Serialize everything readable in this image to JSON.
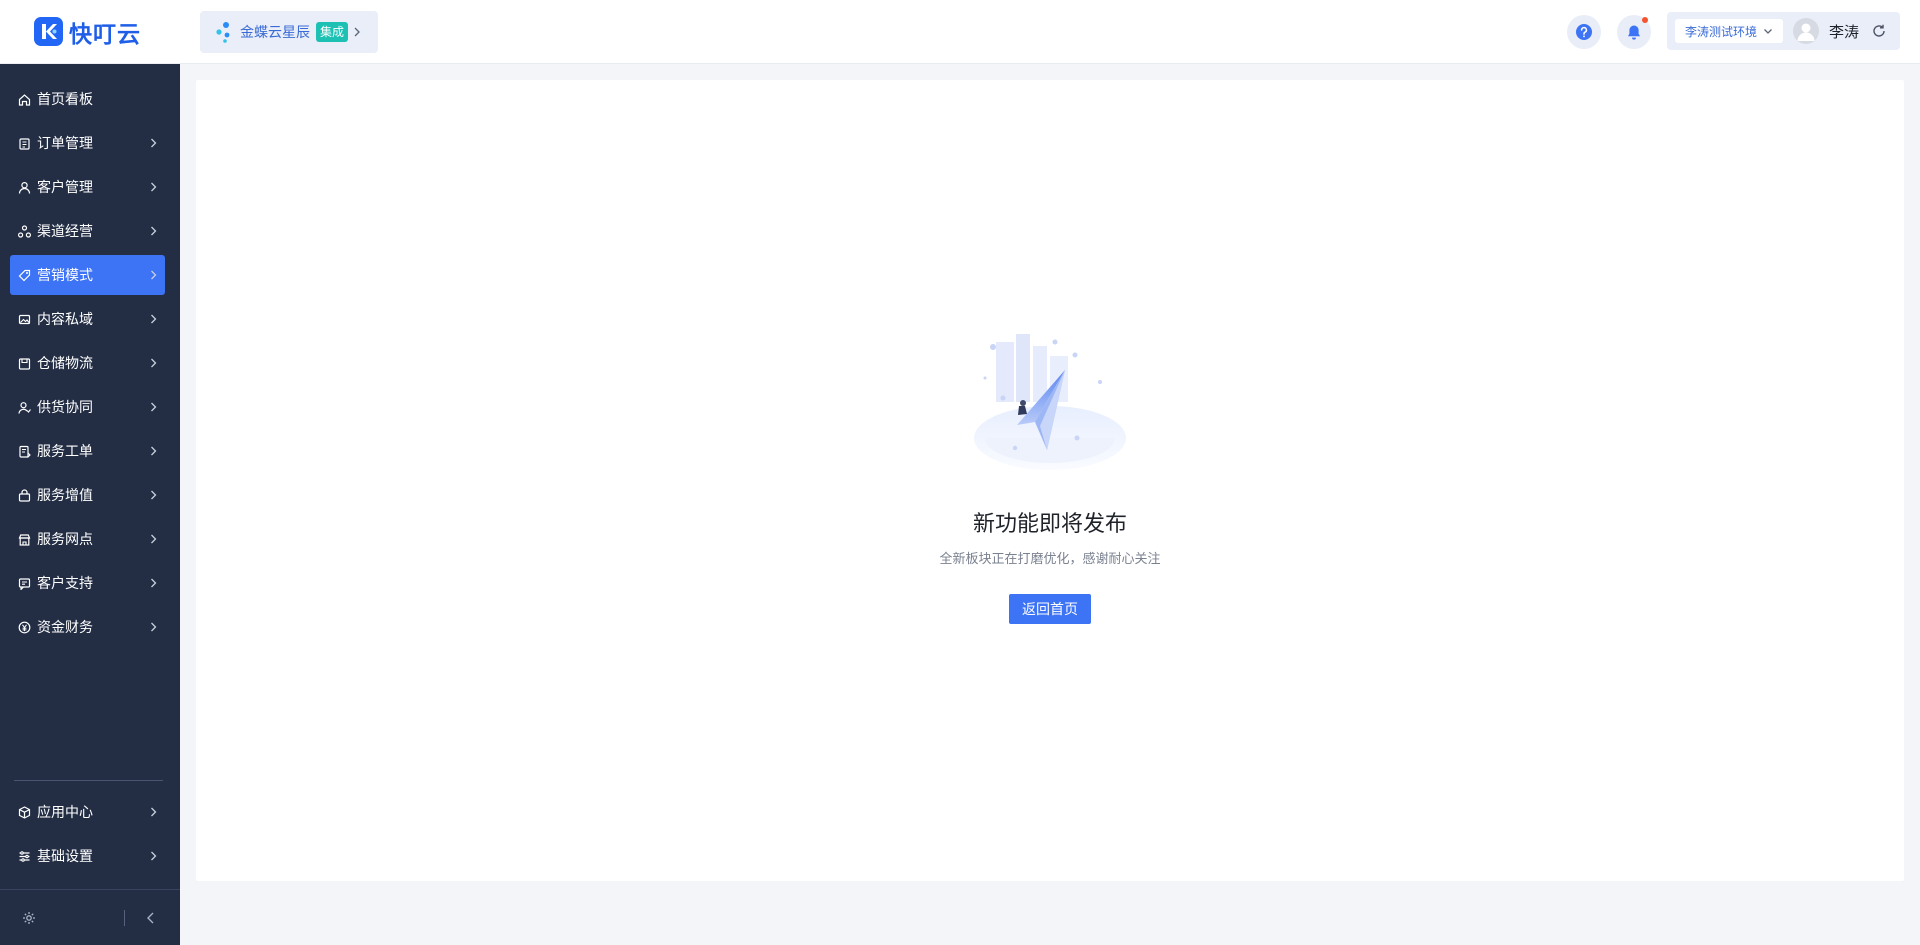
{
  "app": {
    "name": "快叮云",
    "brand_color": "#2266f5"
  },
  "sidebar": {
    "items": [
      {
        "label": "首页看板",
        "icon": "home-icon",
        "has_children": false,
        "active": false
      },
      {
        "label": "订单管理",
        "icon": "clipboard-icon",
        "has_children": true,
        "active": false
      },
      {
        "label": "客户管理",
        "icon": "user-icon",
        "has_children": true,
        "active": false
      },
      {
        "label": "渠道经营",
        "icon": "channel-icon",
        "has_children": true,
        "active": false
      },
      {
        "label": "营销模式",
        "icon": "tag-icon",
        "has_children": true,
        "active": true
      },
      {
        "label": "内容私域",
        "icon": "image-icon",
        "has_children": true,
        "active": false
      },
      {
        "label": "仓储物流",
        "icon": "warehouse-icon",
        "has_children": true,
        "active": false
      },
      {
        "label": "供货协同",
        "icon": "supplier-icon",
        "has_children": true,
        "active": false
      },
      {
        "label": "服务工单",
        "icon": "workorder-icon",
        "has_children": true,
        "active": false
      },
      {
        "label": "服务增值",
        "icon": "bag-icon",
        "has_children": true,
        "active": false
      },
      {
        "label": "服务网点",
        "icon": "store-icon",
        "has_children": true,
        "active": false
      },
      {
        "label": "客户支持",
        "icon": "support-icon",
        "has_children": true,
        "active": false
      },
      {
        "label": "资金财务",
        "icon": "yen-icon",
        "has_children": true,
        "active": false
      }
    ],
    "bottom_items": [
      {
        "label": "应用中心",
        "icon": "cube-icon",
        "has_children": true
      },
      {
        "label": "基础设置",
        "icon": "sliders-icon",
        "has_children": true
      }
    ],
    "active_color": "#3d73f5",
    "bg_color": "#232e45"
  },
  "topbar": {
    "integration": {
      "name": "金蝶云星辰",
      "badge": "集成",
      "badge_color": "#1cc1b4"
    },
    "notification_dot_color": "#f5532d",
    "environment": "李涛测试环境",
    "username": "李涛"
  },
  "main": {
    "empty_state": {
      "title": "新功能即将发布",
      "subtitle": "全新板块正在打磨优化，感谢耐心关注",
      "button_label": "返回首页"
    }
  }
}
